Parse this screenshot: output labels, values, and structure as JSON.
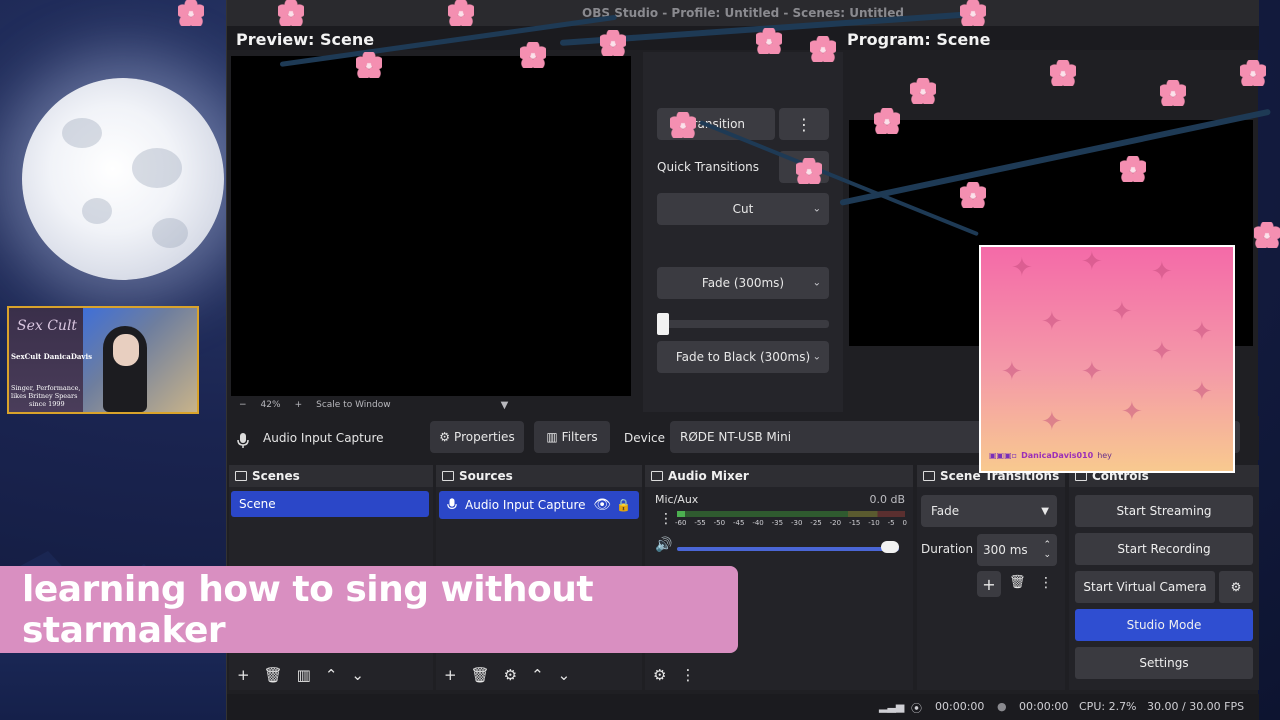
{
  "window": {
    "title": "OBS Studio - Profile: Untitled - Scenes: Untitled"
  },
  "preview": {
    "label": "Preview: Scene",
    "zoom_out": "−",
    "zoom_level": "42%",
    "zoom_in": "+",
    "scale_mode": "Scale to Window"
  },
  "program": {
    "label": "Program: Scene"
  },
  "transitions": {
    "transition_button": "Transition",
    "quick_transitions_label": "Quick Transitions",
    "cut": "Cut",
    "fade": "Fade (300ms)",
    "fade_to_black": "Fade to Black (300ms)"
  },
  "properties_bar": {
    "source_name": "Audio Input Capture",
    "properties": "Properties",
    "filters": "Filters",
    "device_label": "Device",
    "device_value": "RØDE NT-USB Mini"
  },
  "scenes": {
    "title": "Scenes",
    "items": [
      {
        "label": "Scene"
      }
    ]
  },
  "sources": {
    "title": "Sources",
    "items": [
      {
        "label": "Audio Input Capture"
      }
    ]
  },
  "mixer": {
    "title": "Audio Mixer",
    "channel": "Mic/Aux",
    "level": "0.0 dB",
    "scale": [
      "-60",
      "-55",
      "-50",
      "-45",
      "-40",
      "-35",
      "-30",
      "-25",
      "-20",
      "-15",
      "-10",
      "-5",
      "0"
    ],
    "volume_fraction": 1.0
  },
  "scene_transitions": {
    "title": "Scene Transitions",
    "selected": "Fade",
    "duration_label": "Duration",
    "duration_value": "300 ms"
  },
  "controls": {
    "title": "Controls",
    "start_streaming": "Start Streaming",
    "start_recording": "Start Recording",
    "start_virtual_camera": "Start Virtual Camera",
    "studio_mode": "Studio Mode",
    "settings": "Settings"
  },
  "status": {
    "stream_time": "00:00:00",
    "record_time": "00:00:00",
    "cpu": "CPU: 2.7%",
    "fps": "30.00 / 30.00 FPS"
  },
  "webcam": {
    "logo": "Sex Cult",
    "name": "SexCult DanicaDavis",
    "bio_line1": "Singer, Performance,",
    "bio_line2": "likes Britney Spears",
    "bio_line3": "since 1999"
  },
  "chat": {
    "username": "DanicaDavis010",
    "message": "hey"
  },
  "caption": {
    "text": "learning how to sing without starmaker"
  },
  "colors": {
    "accent_blue": "#2b47c8",
    "caption_pink": "#d98fc1",
    "webcam_border": "#d9a32b"
  }
}
